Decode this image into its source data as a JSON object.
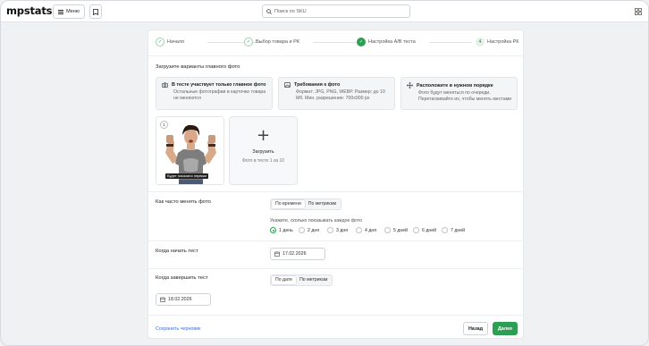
{
  "header": {
    "logo": "mpstats",
    "menu_label": "Меню",
    "search_placeholder": "Поиск по SKU"
  },
  "stepper": [
    {
      "label": "Начало",
      "state": "done",
      "marker": "✓"
    },
    {
      "label": "Выбор товара и РК",
      "state": "done",
      "marker": "✓"
    },
    {
      "label": "Настройка A/B теста",
      "state": "active",
      "marker": "✓"
    },
    {
      "label": "Настройка РК",
      "state": "todo",
      "marker": "4"
    }
  ],
  "photos_section": {
    "title": "Загрузите варианты главного фото",
    "info": [
      {
        "icon": "camera-icon",
        "title": "В тесте участвует только главное фото",
        "text": "Остальные фотографии в карточке товара не меняются"
      },
      {
        "icon": "image-icon",
        "title": "Требования к фото",
        "text": "Формат: JPG, PNG, WEBP. Размер: до 10 Мб. Мин. разрешение: 700х900 px"
      },
      {
        "icon": "move-icon",
        "title": "Расположите в нужном порядке",
        "text": "Фото будут меняться по очереди. Перетаскивайте их, чтобы менять местами"
      }
    ],
    "photo_number": "1",
    "photo_caption": "Будет показано первым",
    "upload_label": "Загрузить",
    "upload_sub": "Фото в тесте 1 из 10"
  },
  "frequency": {
    "title": "Как часто менять фото",
    "options": [
      "По времени",
      "По метрикам"
    ],
    "selected": "По времени",
    "hint": "Укажите, сколько показывать каждое фото",
    "durations": [
      "1 день",
      "2 дня",
      "3 дня",
      "4 дня",
      "5 дней",
      "6 дней",
      "7 дней"
    ],
    "selected_duration": "1 день"
  },
  "start": {
    "title": "Когда начать тест",
    "date": "17.02.2026"
  },
  "finish": {
    "title": "Когда завершить тест",
    "options": [
      "По дате",
      "По метрикам"
    ],
    "selected": "По дате",
    "date": "18.02.2026"
  },
  "footer": {
    "draft_link": "Сохранить черновик",
    "back": "Назад",
    "next": "Далее"
  },
  "colors": {
    "accent": "#2e9e54",
    "link": "#3b6fd8"
  }
}
